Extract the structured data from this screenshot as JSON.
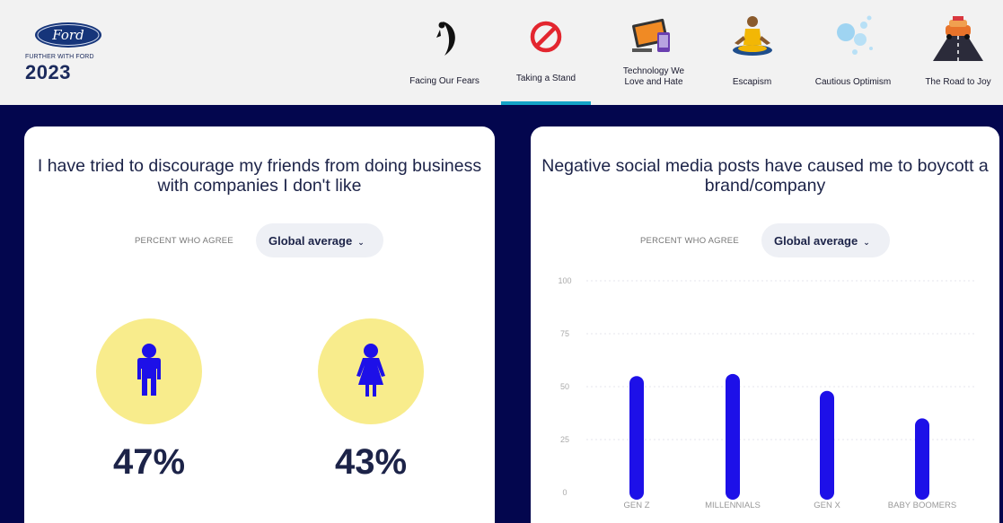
{
  "brand": {
    "logo_text": "Ford",
    "tagline": "FURTHER WITH FORD",
    "year": "2023"
  },
  "nav": {
    "items": [
      {
        "label": "Facing Our Fears",
        "icon": "moon-figure-icon"
      },
      {
        "label": "Taking a Stand",
        "icon": "prohibited-icon",
        "active": true
      },
      {
        "label": "Technology We Love and Hate",
        "icon": "devices-icon"
      },
      {
        "label": "Escapism",
        "icon": "meditation-icon"
      },
      {
        "label": "Cautious Optimism",
        "icon": "bubbles-icon"
      },
      {
        "label": "The Road to Joy",
        "icon": "car-road-icon"
      }
    ]
  },
  "left_card": {
    "title": "I have tried to discourage my friends from doing business with companies I don't like",
    "filter_label": "PERCENT WHO AGREE",
    "filter_value": "Global average",
    "male_value": "47%",
    "female_value": "43%"
  },
  "right_card": {
    "title": "Negative social media posts have caused me to boycott a brand/company",
    "filter_label": "PERCENT WHO AGREE",
    "filter_value": "Global average"
  },
  "chart_data": {
    "type": "bar",
    "categories": [
      "GEN Z",
      "MILLENNIALS",
      "GEN X",
      "BABY BOOMERS"
    ],
    "values": [
      55,
      56,
      48,
      35
    ],
    "yticks": [
      0,
      25,
      50,
      75,
      100
    ],
    "ylim": [
      0,
      100
    ],
    "grid": true,
    "bar_color": "#1d10e8"
  },
  "colors": {
    "navy_background": "#03064e",
    "accent_bar": "#15a3c8",
    "person_circle": "#f8ec8c",
    "person_figure": "#1d10e8",
    "title_text": "#1c2348"
  }
}
